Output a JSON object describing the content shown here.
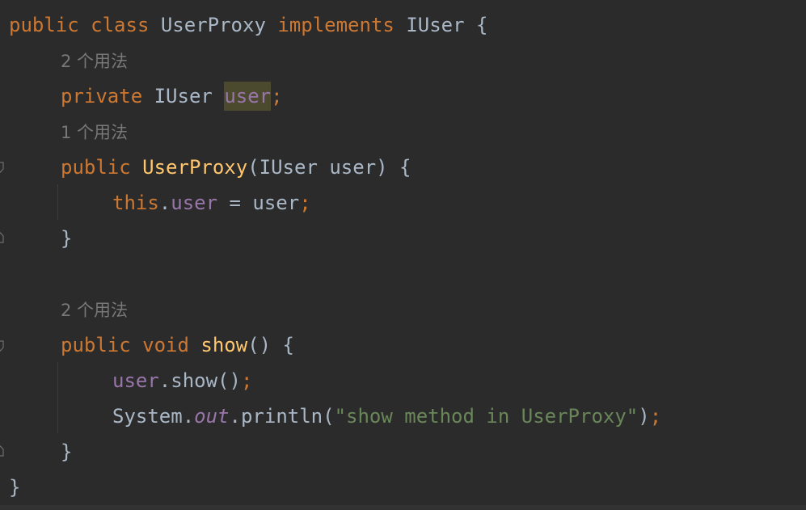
{
  "editor": {
    "line1": {
      "kw_public": "public",
      "kw_class": "class",
      "classname": "UserProxy",
      "kw_implements": "implements",
      "iface": "IUser",
      "brace": "{"
    },
    "hint1": "2 个用法",
    "line2": {
      "kw_private": "private",
      "type": "IUser",
      "field": "user",
      "semi": ";"
    },
    "hint2": "1 个用法",
    "line3": {
      "kw_public": "public",
      "ctor": "UserProxy",
      "open": "(",
      "type": "IUser",
      "param": "user",
      "close": ") {"
    },
    "line4": {
      "kw_this": "this",
      "dot": ".",
      "field": "user",
      "eq": " = ",
      "param": "user",
      "semi": ";"
    },
    "line5": {
      "brace": "}"
    },
    "hint3": "2 个用法",
    "line6": {
      "kw_public": "public",
      "kw_void": "void",
      "method": "show",
      "rest": "() {"
    },
    "line7": {
      "field": "user",
      "call": ".show()",
      "semi": ";"
    },
    "line8": {
      "cls": "System",
      "dot1": ".",
      "out": "out",
      "call": ".println(",
      "str": "\"show method in UserProxy\"",
      "close": ")",
      "semi": ";"
    },
    "line9": {
      "brace": "}"
    },
    "line10": {
      "brace": "}"
    }
  }
}
